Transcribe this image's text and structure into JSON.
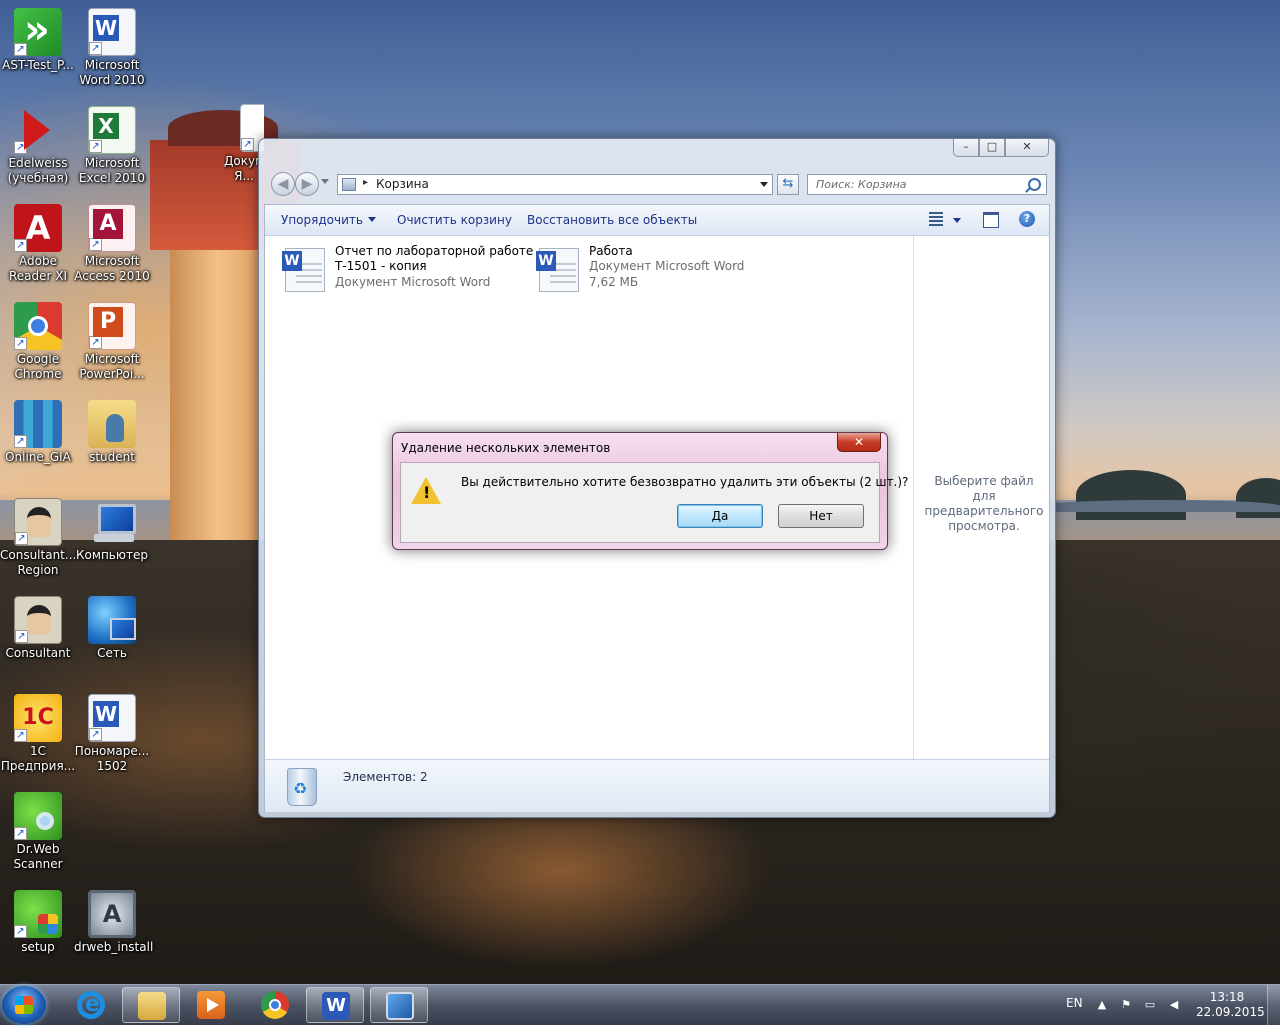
{
  "desktop": {
    "icons": [
      {
        "label": "AST-Test_P...",
        "icon": "ast-test-icon"
      },
      {
        "label": "Microsoft Word 2010",
        "icon": "word-icon"
      },
      {
        "label": "Edelweiss (учебная)",
        "icon": "edelweiss-icon"
      },
      {
        "label": "Microsoft Excel 2010",
        "icon": "excel-icon"
      },
      {
        "label": "Докум... Я...",
        "icon": "document-icon"
      },
      {
        "label": "Adobe Reader XI",
        "icon": "adobe-reader-icon"
      },
      {
        "label": "Microsoft Access 2010",
        "icon": "access-icon"
      },
      {
        "label": "Google Chrome",
        "icon": "chrome-icon"
      },
      {
        "label": "Microsoft PowerPoi...",
        "icon": "powerpoint-icon"
      },
      {
        "label": "Online_GIA",
        "icon": "books-icon"
      },
      {
        "label": "student",
        "icon": "user-folder-icon"
      },
      {
        "label": "Consultant... Region",
        "icon": "consultant-icon"
      },
      {
        "label": "Компьютер",
        "icon": "computer-icon"
      },
      {
        "label": "Consultant",
        "icon": "consultant-icon"
      },
      {
        "label": "Сеть",
        "icon": "network-icon"
      },
      {
        "label": "1С Предприя...",
        "icon": "1c-icon"
      },
      {
        "label": "Пономаре... 1502",
        "icon": "word-doc-icon"
      },
      {
        "label": "Dr.Web Scanner",
        "icon": "drweb-scanner-icon"
      },
      {
        "label": "setup",
        "icon": "setup-icon"
      },
      {
        "label": "drweb_install",
        "icon": "drweb-install-icon"
      }
    ]
  },
  "explorer": {
    "window_controls": {
      "minimize": "–",
      "maximize": "□",
      "close": "✕"
    },
    "address": {
      "separator": "▸",
      "location": "Корзина"
    },
    "search_placeholder": "Поиск: Корзина",
    "toolbar": {
      "organize": "Упорядочить",
      "empty_bin": "Очистить корзину",
      "restore_all": "Восстановить все объекты",
      "help": "?"
    },
    "files": [
      {
        "name_line1": "Отчет по лабораторной работе",
        "name_line2": "Т-1501 - копия",
        "type": "Документ Microsoft Word",
        "size": ""
      },
      {
        "name_line1": "Работа",
        "name_line2": "",
        "type": "Документ Microsoft Word",
        "size": "7,62 МБ"
      }
    ],
    "preview_text": "Выберите файл для предварительного просмотра.",
    "status": "Элементов: 2"
  },
  "dialog": {
    "title": "Удаление нескольких элементов",
    "close": "✕",
    "message": "Вы действительно хотите безвозвратно удалить эти объекты (2 шт.)?",
    "yes": "Да",
    "no": "Нет"
  },
  "taskbar": {
    "apps": [
      {
        "name": "internet-explorer",
        "active": false
      },
      {
        "name": "file-explorer",
        "active": true
      },
      {
        "name": "media-player",
        "active": false
      },
      {
        "name": "chrome",
        "active": false
      },
      {
        "name": "word",
        "active": true
      },
      {
        "name": "remote-desktop",
        "active": true
      }
    ],
    "language": "EN",
    "time": "13:18",
    "date": "22.09.2015"
  },
  "colors": {
    "link_blue": "#1e3287",
    "dialog_frame": "#e9c2dc",
    "close_red": "#c63d27",
    "default_button": "#bee6fd"
  }
}
